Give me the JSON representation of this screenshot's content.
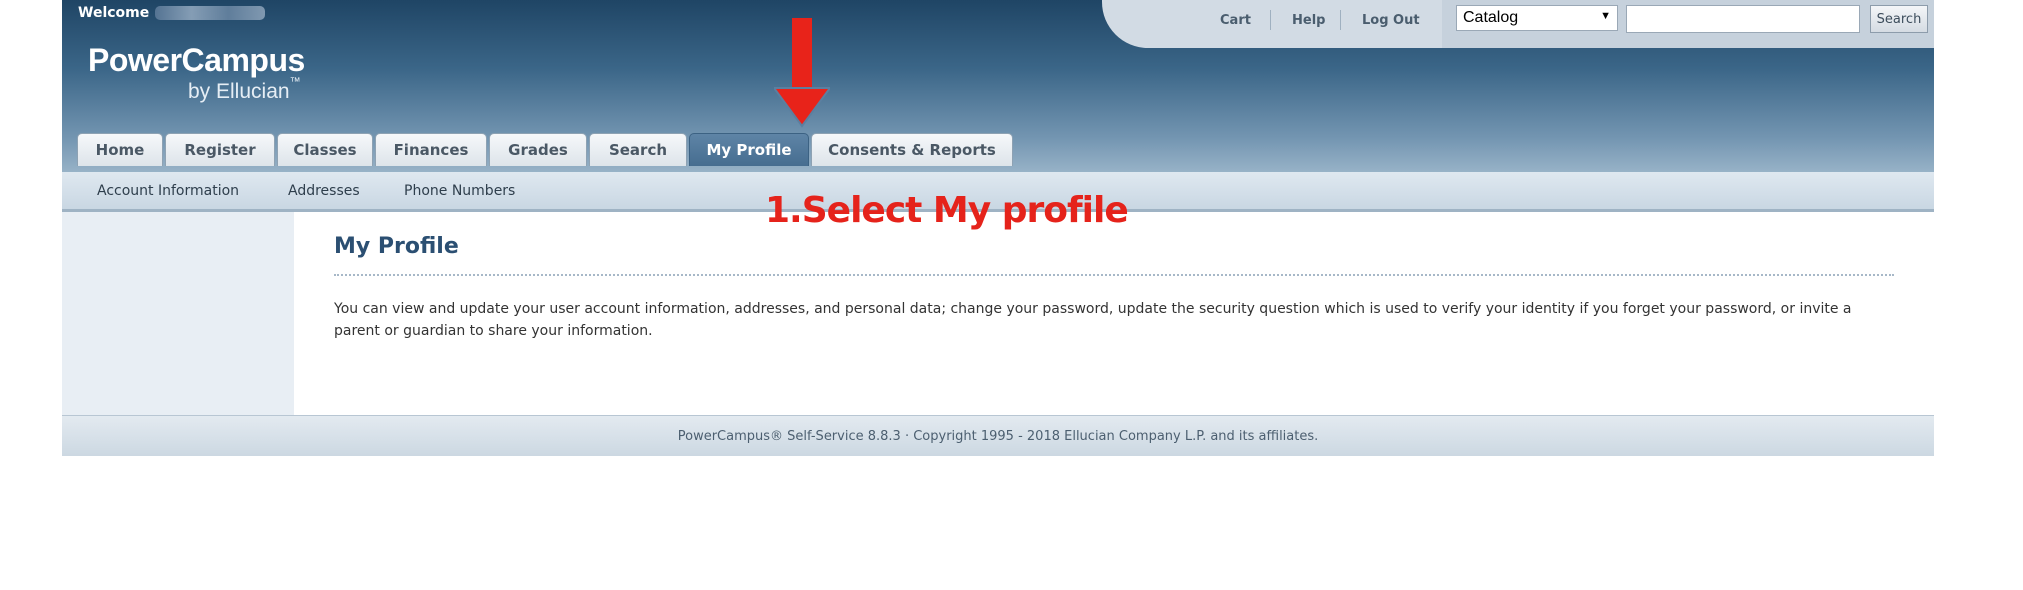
{
  "header": {
    "welcome_label": "Welcome",
    "brand_title": "PowerCampus",
    "brand_sub": "by Ellucian",
    "brand_tm": "™"
  },
  "utility_links": [
    "Cart",
    "Help",
    "Log Out"
  ],
  "catalog": {
    "selected": "Catalog",
    "search_value": "",
    "search_button": "Search"
  },
  "tabs": [
    {
      "label": "Home"
    },
    {
      "label": "Register"
    },
    {
      "label": "Classes"
    },
    {
      "label": "Finances"
    },
    {
      "label": "Grades"
    },
    {
      "label": "Search"
    },
    {
      "label": "My Profile",
      "active": true
    },
    {
      "label": "Consents & Reports"
    }
  ],
  "subnav": [
    "Account Information",
    "Addresses",
    "Phone Numbers"
  ],
  "main": {
    "title": "My Profile",
    "body": "You can view and update your user account information, addresses, and personal data; change your password, update the security question which is used to verify your identity if you forget your password, or invite a parent or guardian to share your information."
  },
  "footer": {
    "text": "PowerCampus® Self-Service 8.8.3 · Copyright 1995 - 2018 Ellucian Company L.P. and its affiliates."
  },
  "annotation": {
    "text": "1.Select My profile",
    "color": "#e5231b",
    "arrow_icon": "down-arrow-icon"
  },
  "colors": {
    "header_dark": "#1f4565",
    "tab_active": "#4f7697",
    "title": "#2b4f72"
  }
}
